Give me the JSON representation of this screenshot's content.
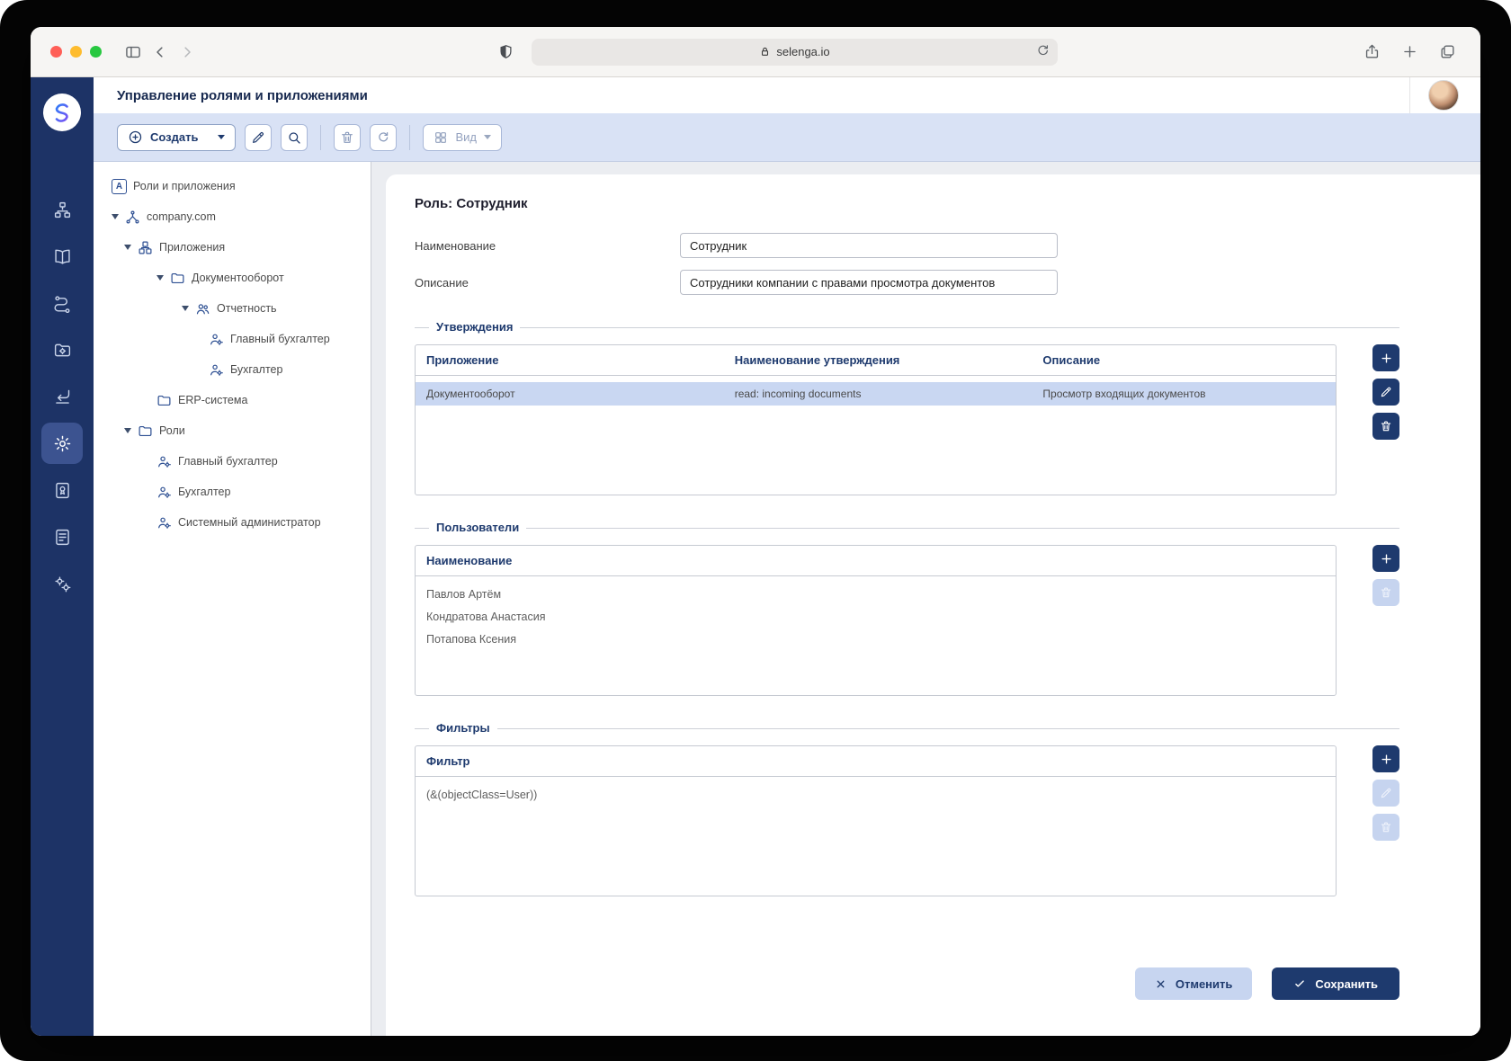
{
  "browser": {
    "url": "selenga.io"
  },
  "header": {
    "title": "Управление ролями и приложениями"
  },
  "toolbar": {
    "create_label": "Создать",
    "view_label": "Вид"
  },
  "icons": {
    "tree_root_glyph": "A"
  },
  "tree": {
    "items": [
      {
        "label": "Роли и приложения",
        "level": 0,
        "icon": "tree-root"
      },
      {
        "label": "company.com",
        "level": 0,
        "icon": "domain",
        "expanded": true
      },
      {
        "label": "Приложения",
        "level": 1,
        "icon": "applications",
        "expanded": true
      },
      {
        "label": "Документооборот",
        "level": 2,
        "icon": "folder",
        "expanded": true
      },
      {
        "label": "Отчетность",
        "level": 3,
        "icon": "group",
        "expanded": true
      },
      {
        "label": "Главный бухгалтер",
        "level": 4,
        "icon": "role"
      },
      {
        "label": "Бухгалтер",
        "level": 4,
        "icon": "role"
      },
      {
        "label": "ERP-система",
        "level": 2,
        "icon": "folder"
      },
      {
        "label": "Роли",
        "level": 1,
        "icon": "folder",
        "expanded": true
      },
      {
        "label": "Главный бухгалтер",
        "level": 2,
        "icon": "role"
      },
      {
        "label": "Бухгалтер",
        "level": 2,
        "icon": "role"
      },
      {
        "label": "Системный администратор",
        "level": 2,
        "icon": "role"
      }
    ]
  },
  "form": {
    "title": "Роль: Сотрудник",
    "name_label": "Наименование",
    "name_value": "Сотрудник",
    "desc_label": "Описание",
    "desc_value": "Сотрудники компании с правами просмотра документов"
  },
  "statements": {
    "legend": "Утверждения",
    "columns": [
      "Приложение",
      "Наименование утверждения",
      "Описание"
    ],
    "row": {
      "app": "Документооборот",
      "name": "read: incoming documents",
      "desc": "Просмотр входящих документов"
    }
  },
  "users": {
    "legend": "Пользователи",
    "column": "Наименование",
    "rows": [
      "Павлов Артём",
      "Кондратова Анастасия",
      "Потапова Ксения"
    ]
  },
  "filters": {
    "legend": "Фильтры",
    "column": "Фильтр",
    "rows": [
      "(&(objectClass=User))"
    ]
  },
  "footer": {
    "cancel_label": "Отменить",
    "save_label": "Сохранить"
  },
  "colors": {
    "navy": "#1e3a6e",
    "sidebar": "#1d3366",
    "toolbar_bg": "#d9e2f5",
    "selected_row": "#c9d7f2",
    "disabled_action": "#c6d4ef"
  }
}
